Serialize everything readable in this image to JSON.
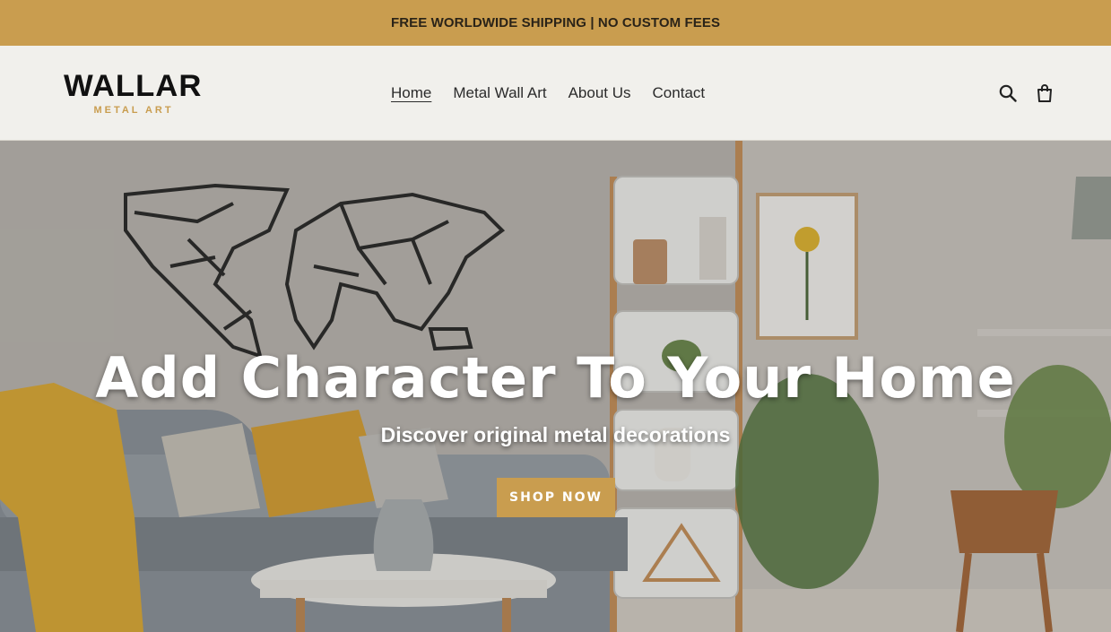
{
  "announcement": {
    "text": "FREE WORLDWIDE SHIPPING | NO CUSTOM FEES"
  },
  "header": {
    "logo": {
      "main": "WALLAR",
      "sub": "METAL ART"
    },
    "nav": [
      {
        "label": "Home",
        "active": true
      },
      {
        "label": "Metal Wall Art",
        "active": false
      },
      {
        "label": "About Us",
        "active": false
      },
      {
        "label": "Contact",
        "active": false
      }
    ],
    "icons": {
      "search": "search-icon",
      "cart": "cart-icon"
    }
  },
  "hero": {
    "title": "Add Character To Your Home",
    "subtitle": "Discover original metal decorations",
    "button_label": "SHOP NOW"
  },
  "colors": {
    "accent": "#c99d4f",
    "header_bg": "#f1f0ec",
    "text_dark": "#2b2b2b"
  }
}
